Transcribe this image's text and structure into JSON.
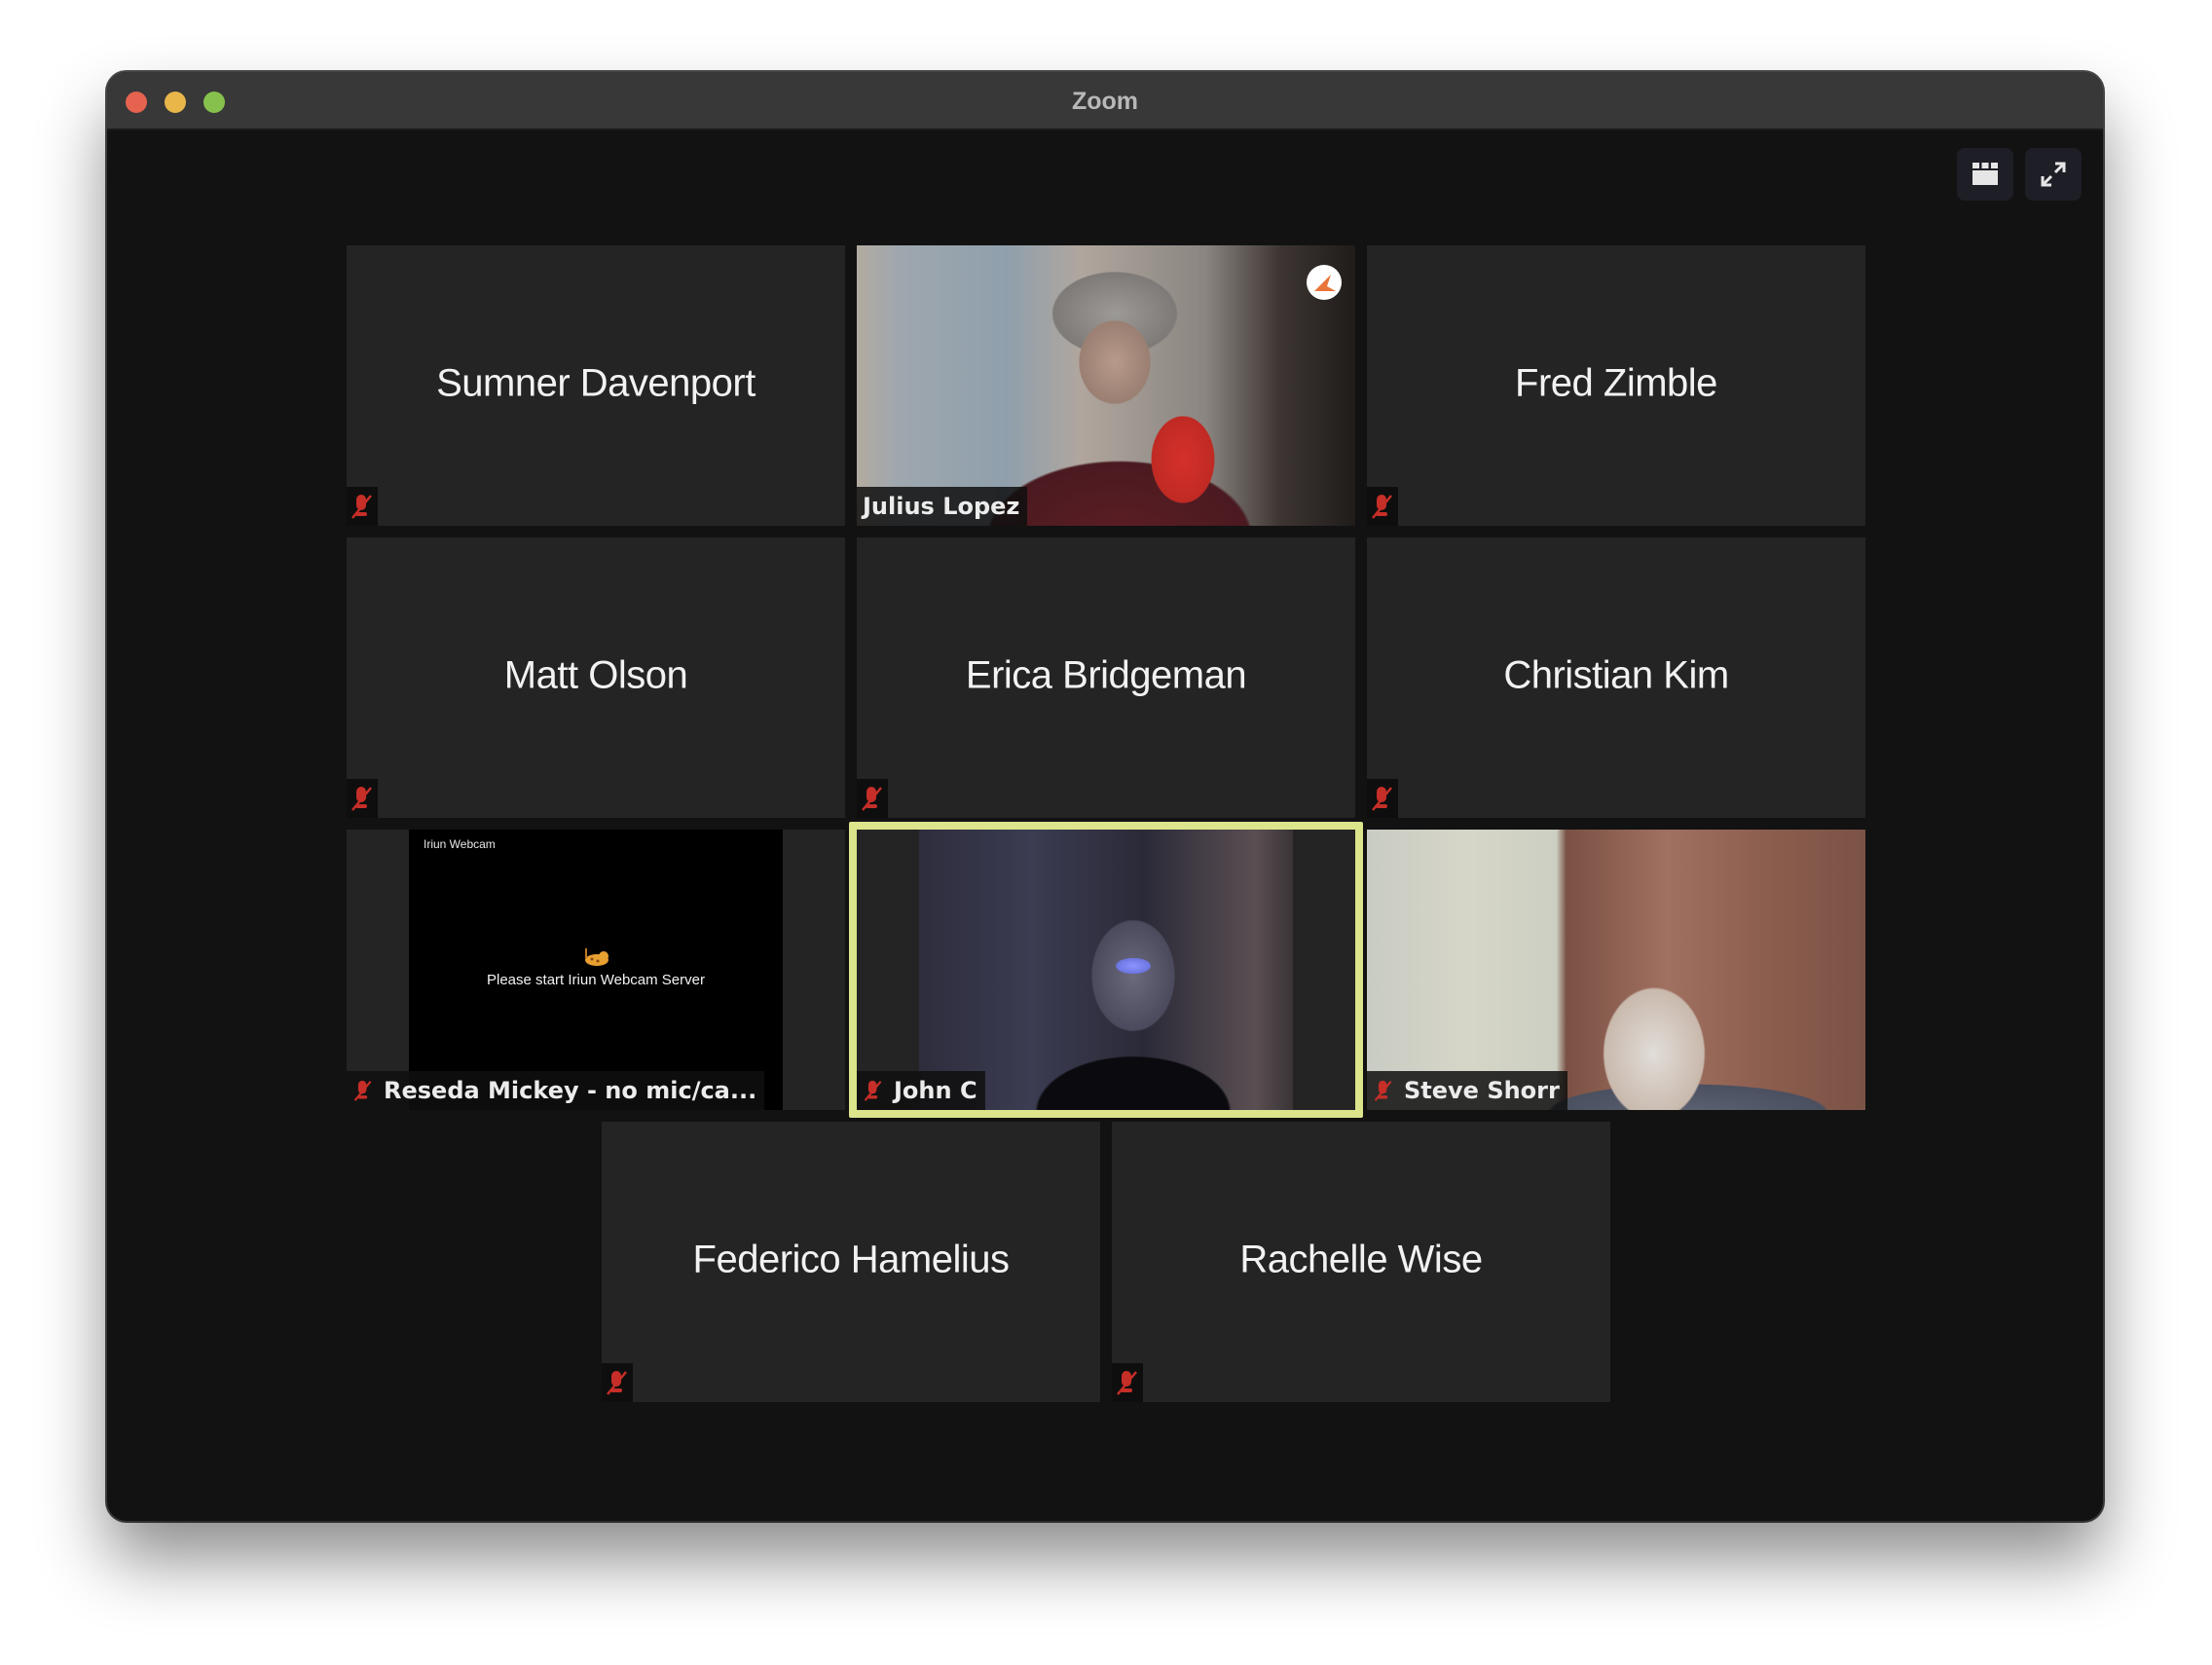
{
  "window": {
    "title": "Zoom",
    "controls": [
      "close",
      "minimize",
      "maximize"
    ]
  },
  "toolbar": {
    "gallery_view_icon": "gallery-view-icon",
    "fullscreen_icon": "expand-fullscreen-icon"
  },
  "active_speaker_color": "#dce48c",
  "muted_icon_color": "#d0302a",
  "participants": [
    {
      "name": "Sumner Davenport",
      "video": false,
      "muted": true
    },
    {
      "name": "Julius Lopez",
      "video": true,
      "muted": false,
      "badge": "presenter-logo-icon"
    },
    {
      "name": "Fred Zimble",
      "video": false,
      "muted": true
    },
    {
      "name": "Matt Olson",
      "video": false,
      "muted": true
    },
    {
      "name": "Erica Bridgeman",
      "video": false,
      "muted": true
    },
    {
      "name": "Christian Kim",
      "video": false,
      "muted": true
    },
    {
      "name": "Reseda Mickey - no mic/ca...",
      "video": true,
      "muted": true,
      "video_content": {
        "app_title": "Iriun Webcam",
        "message": "Please start Iriun Webcam Server"
      }
    },
    {
      "name": "John C",
      "video": true,
      "muted": true,
      "active_speaker": true
    },
    {
      "name": "Steve Shorr",
      "video": true,
      "muted": true
    },
    {
      "name": "Federico Hamelius",
      "video": false,
      "muted": true
    },
    {
      "name": "Rachelle Wise",
      "video": false,
      "muted": true
    }
  ]
}
